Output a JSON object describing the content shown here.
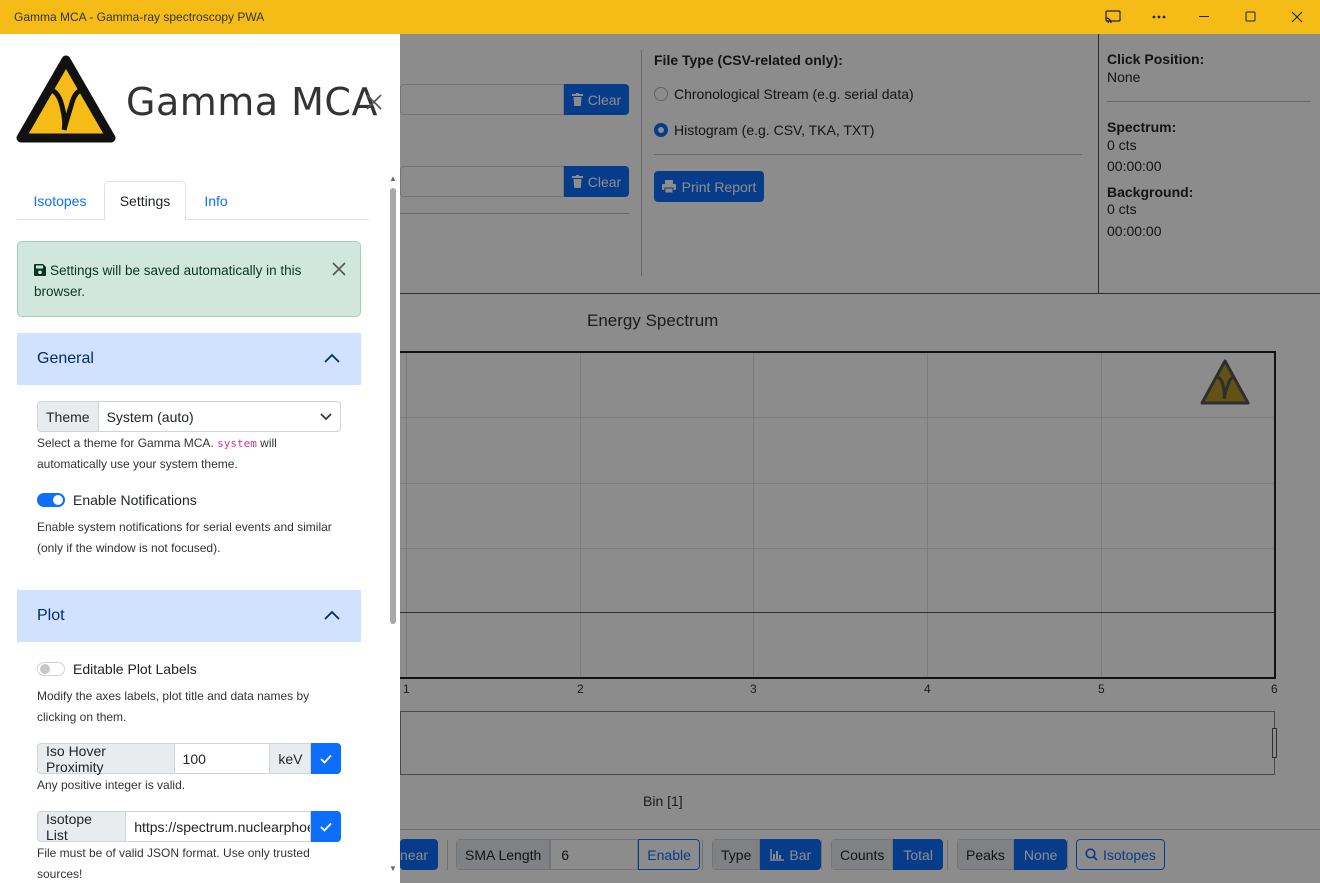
{
  "window": {
    "title": "Gamma MCA - Gamma-ray spectroscopy PWA"
  },
  "main": {
    "clear_label_1": "Clear",
    "clear_label_2": "Clear",
    "file_type": {
      "title": "File Type (CSV-related only):",
      "options": [
        {
          "label": "Chronological Stream (e.g. serial data)",
          "selected": false
        },
        {
          "label": "Histogram (e.g. CSV, TKA, TXT)",
          "selected": true
        }
      ]
    },
    "print_label": "Print Report",
    "info": {
      "click_title": "Click Position:",
      "click_value": "None",
      "spectrum_title": "Spectrum:",
      "spectrum_counts": "0 cts",
      "spectrum_time": "00:00:00",
      "background_title": "Background:",
      "background_counts": "0 cts",
      "background_time": "00:00:00"
    },
    "plot": {
      "title": "Energy Spectrum",
      "xlabel": "Bin [1]",
      "xticks": [
        "1",
        "2",
        "3",
        "4",
        "5",
        "6"
      ]
    },
    "toolbar": {
      "scale_value": "Linear",
      "scale_visible": "near",
      "sma_label": "SMA Length",
      "sma_value": "6",
      "sma_button": "Enable",
      "type_label": "Type",
      "type_value": "Bar",
      "counts_label": "Counts",
      "counts_value": "Total",
      "peaks_label": "Peaks",
      "peaks_value": "None",
      "isotopes_button": "Isotopes"
    }
  },
  "sidebar": {
    "brand": "Gamma MCA",
    "tabs": [
      {
        "label": "Isotopes",
        "active": false
      },
      {
        "label": "Settings",
        "active": true
      },
      {
        "label": "Info",
        "active": false
      }
    ],
    "alert": "Settings will be saved automatically in this browser.",
    "general": {
      "heading": "General",
      "theme_label": "Theme",
      "theme_value": "System (auto)",
      "theme_help_pre": "Select a theme for Gamma MCA.",
      "theme_help_code": "system",
      "theme_help_post": "will automatically use your system theme.",
      "notif_label": "Enable Notifications",
      "notif_enabled": true,
      "notif_help": "Enable system notifications for serial events and similar (only if the window is not focused)."
    },
    "plot": {
      "heading": "Plot",
      "editable_label": "Editable Plot Labels",
      "editable_enabled": false,
      "editable_help": "Modify the axes labels, plot title and data names by clicking on them.",
      "iso_label": "Iso Hover Proximity",
      "iso_value": "100",
      "iso_unit": "keV",
      "iso_help": "Any positive integer is valid.",
      "list_label": "Isotope List",
      "list_value": "https://spectrum.nuclearphoenix.xyz/assets/isotopes_energies_min.json",
      "list_help": "File must be of valid JSON format. Use only trusted sources!"
    }
  },
  "colors": {
    "titlebar": "#f5bc17",
    "primary": "#0d6efd",
    "accordion": "#cfe2ff",
    "alert_bg": "#d1e7dd"
  }
}
